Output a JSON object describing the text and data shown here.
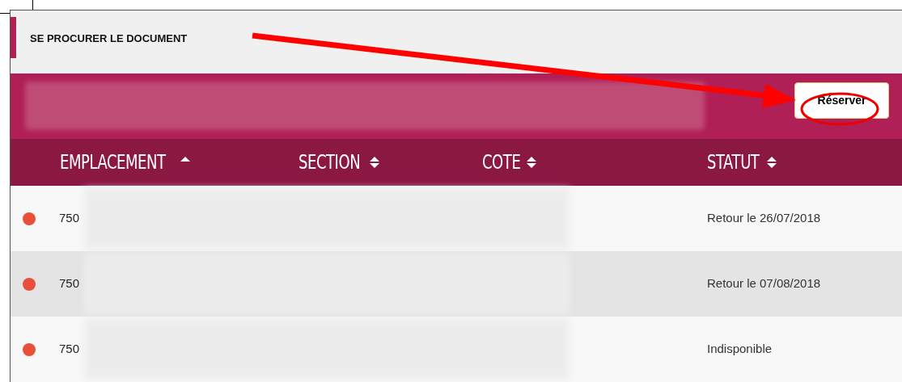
{
  "section_title": "SE PROCURER LE DOCUMENT",
  "reserve_button": {
    "label": "Réserver"
  },
  "table": {
    "columns": [
      {
        "label": "EMPLACEMENT",
        "sorted": true
      },
      {
        "label": "SECTION",
        "sorted": false
      },
      {
        "label": "COTE",
        "sorted": false
      },
      {
        "label": "STATUT",
        "sorted": false
      }
    ],
    "rows": [
      {
        "location": "750",
        "status": "Retour le 26/07/2018",
        "color": "#e8503a"
      },
      {
        "location": "750",
        "status": "Retour le 07/08/2018",
        "color": "#e8503a"
      },
      {
        "location": "750",
        "status": "Indisponible",
        "color": "#e8503a"
      }
    ]
  }
}
